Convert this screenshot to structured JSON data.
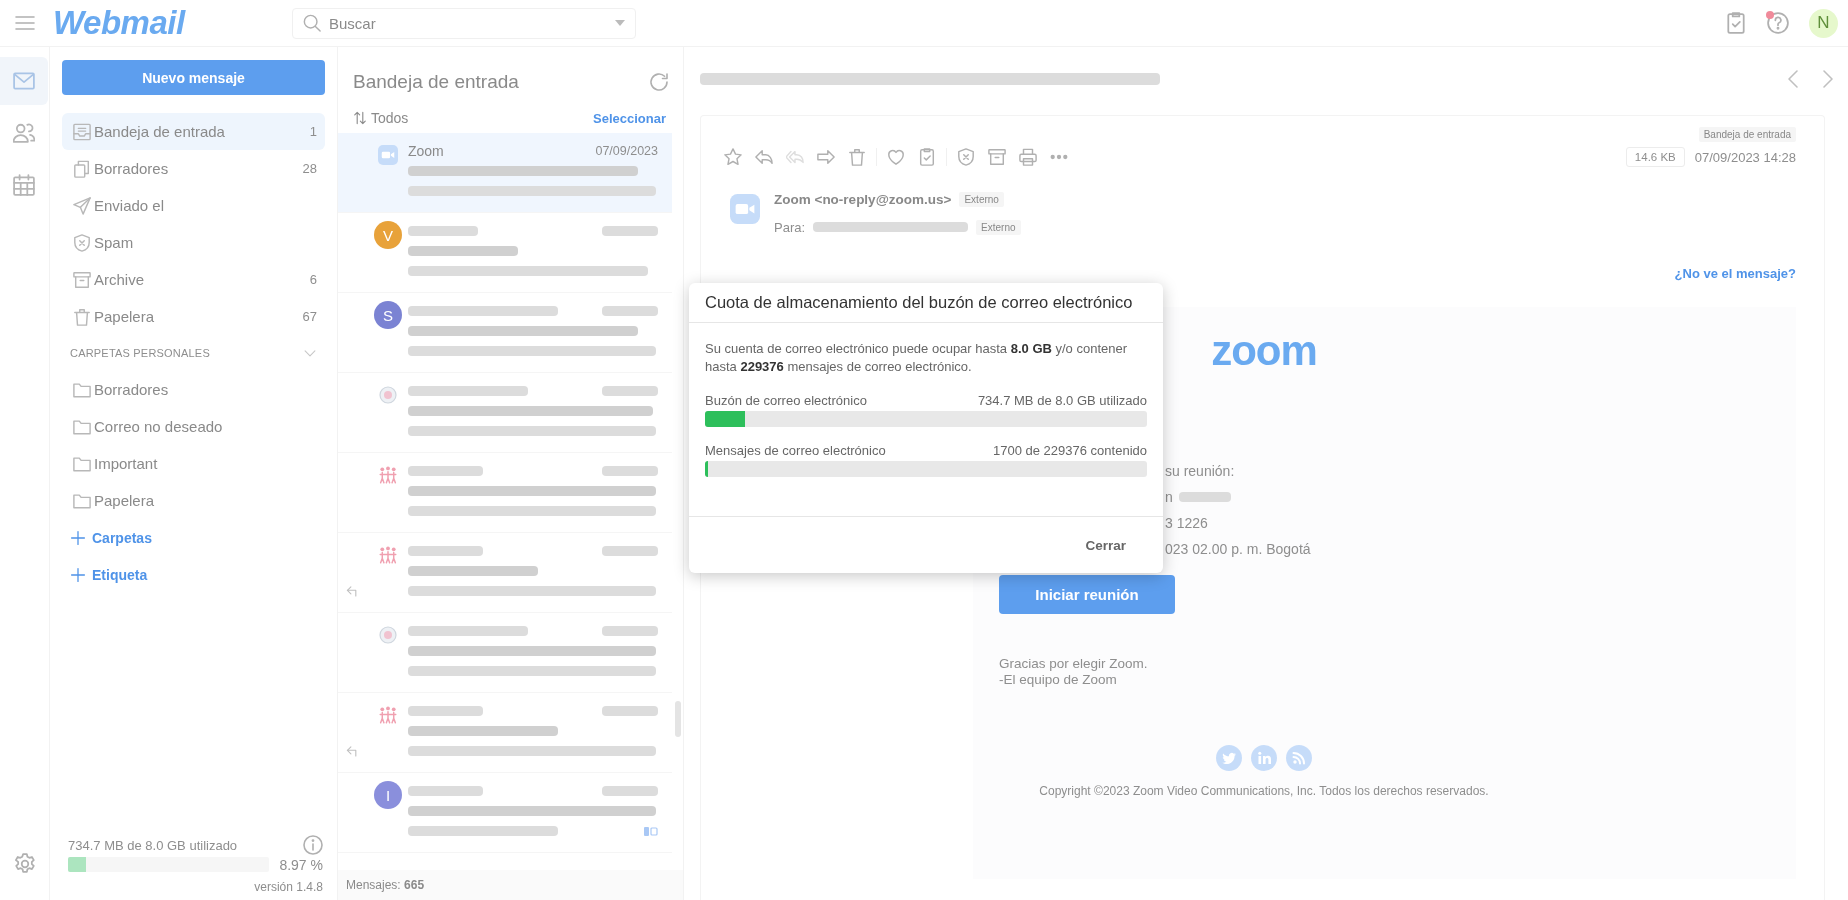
{
  "top_bar": {
    "logo": "Webmail",
    "search": {
      "placeholder": "Buscar"
    },
    "help_notification": true,
    "avatar": {
      "letter": "N"
    }
  },
  "rail": [
    {
      "kind": "mail",
      "selected": true
    },
    {
      "kind": "contacts",
      "selected": false
    },
    {
      "kind": "calendar",
      "selected": false
    }
  ],
  "new_message_button": "Nuevo mensaje",
  "folders": [
    {
      "kind": "inbox",
      "label": "Bandeja de entrada",
      "count": "1",
      "selected": true
    },
    {
      "kind": "drafts",
      "label": "Borradores",
      "count": "28",
      "selected": false
    },
    {
      "kind": "sent",
      "label": "Enviado el",
      "selected": false
    },
    {
      "kind": "spam",
      "label": "Spam",
      "selected": false
    },
    {
      "kind": "archive",
      "label": "Archive",
      "count": "6",
      "selected": false
    },
    {
      "kind": "trash",
      "label": "Papelera",
      "count": "67",
      "selected": false
    }
  ],
  "personal_folders": {
    "title": "CARPETAS PERSONALES",
    "expanded": true,
    "items": [
      {
        "label": "Borradores",
        "selected": false
      },
      {
        "label": "Correo no deseado",
        "selected": false
      },
      {
        "label": "Important",
        "selected": false
      },
      {
        "label": "Papelera",
        "selected": false
      }
    ]
  },
  "add_links": [
    {
      "label": "Carpetas"
    },
    {
      "label": "Etiqueta"
    }
  ],
  "storage": {
    "usage": "734.7 MB de 8.0 GB utilizado",
    "level": 0.0897,
    "percent": "8.97 %",
    "version": "versión 1.4.8"
  },
  "message_list": {
    "title": "Bandeja de entrada",
    "sort": "Todos",
    "select": "Seleccionar",
    "messages": [
      {
        "avatar": {
          "kind": "zoom"
        },
        "sender": "Zoom",
        "date": "07/09/2023",
        "blurred": true,
        "replied": false,
        "labelled": false,
        "selected": true
      },
      {
        "avatar": {
          "kind": "letter",
          "letter": "V",
          "color": "#e8a23a"
        },
        "blurred": true,
        "replied": false,
        "labelled": false,
        "selected": false
      },
      {
        "avatar": {
          "kind": "letter",
          "letter": "S",
          "color": "#7b83d3"
        },
        "blurred": true,
        "replied": false,
        "labelled": false,
        "selected": false
      },
      {
        "avatar": {
          "kind": "target"
        },
        "blurred": true,
        "replied": false,
        "labelled": false,
        "selected": false
      },
      {
        "avatar": {
          "kind": "people"
        },
        "blurred": true,
        "replied": false,
        "labelled": false,
        "selected": false
      },
      {
        "avatar": {
          "kind": "people"
        },
        "blurred": true,
        "replied": true,
        "labelled": false,
        "selected": false
      },
      {
        "avatar": {
          "kind": "target"
        },
        "blurred": true,
        "replied": false,
        "labelled": false,
        "selected": false
      },
      {
        "avatar": {
          "kind": "people"
        },
        "blurred": true,
        "replied": true,
        "labelled": false,
        "selected": false
      },
      {
        "avatar": {
          "kind": "letter",
          "letter": "I",
          "color": "#8a8fdc"
        },
        "blurred": true,
        "replied": false,
        "labelled": true,
        "selected": false
      }
    ],
    "total": "Mensajes: **665**"
  },
  "reading_pane": {
    "subject_blurred": true,
    "folder_tag": "Bandeja de entrada",
    "toolbar": [
      {
        "buttons": [
          {
            "kind": "star",
            "disabled": false
          },
          {
            "kind": "reply",
            "disabled": false
          },
          {
            "kind": "reply_all",
            "disabled": true
          },
          {
            "kind": "forward",
            "disabled": false
          },
          {
            "kind": "delete",
            "disabled": false
          }
        ]
      },
      {
        "buttons": [
          {
            "kind": "favorite",
            "disabled": false
          },
          {
            "kind": "task",
            "disabled": false
          }
        ]
      },
      {
        "buttons": [
          {
            "kind": "spam",
            "disabled": false
          },
          {
            "kind": "archive",
            "disabled": false
          },
          {
            "kind": "print",
            "disabled": false
          },
          {
            "kind": "more",
            "disabled": false
          }
        ]
      }
    ],
    "size": "14.6 KB",
    "date": "07/09/2023 14:28",
    "avatar": {
      "kind": "zoom"
    },
    "sender": "Zoom <no-reply@zoom.us>",
    "sender_tag": "Externo",
    "to_label": "Para:",
    "recipient_blurred": true,
    "recipient_tag": "Externo",
    "view_link": "¿No ve el mensaje?",
    "body": {
      "logo": "zoom",
      "lines": [
        {
          "text": "su reunión:",
          "blurred": false
        },
        {
          "text": "n",
          "blurred": true
        },
        {
          "text": "3 1226",
          "blurred": false
        },
        {
          "text": "023 02.00 p. m. Bogotá",
          "blurred": false
        }
      ],
      "button": "Iniciar reunión",
      "closing": [
        "Gracias por elegir Zoom.",
        "-El equipo de Zoom"
      ],
      "social": [
        {
          "kind": "twitter"
        },
        {
          "kind": "linkedin"
        },
        {
          "kind": "rss"
        }
      ],
      "copyright": "Copyright ©2023 Zoom Video Communications, Inc. Todos los derechos reservados."
    }
  },
  "modal": {
    "title": "Cuota de almacenamiento del buzón de correo electrónico",
    "description": "Su cuenta de correo electrónico puede ocupar hasta **8.0 GB** y/o contener hasta **229376** mensajes de correo electrónico.",
    "meters": [
      {
        "label": "Buzón de correo electrónico",
        "reading": "734.7 MB de 8.0 GB utilizado",
        "level": 0.0897
      },
      {
        "label": "Mensajes de correo electrónico",
        "reading": "1700 de 229376 contenido",
        "level": 0.0074
      }
    ],
    "close_button": "Cerrar"
  }
}
